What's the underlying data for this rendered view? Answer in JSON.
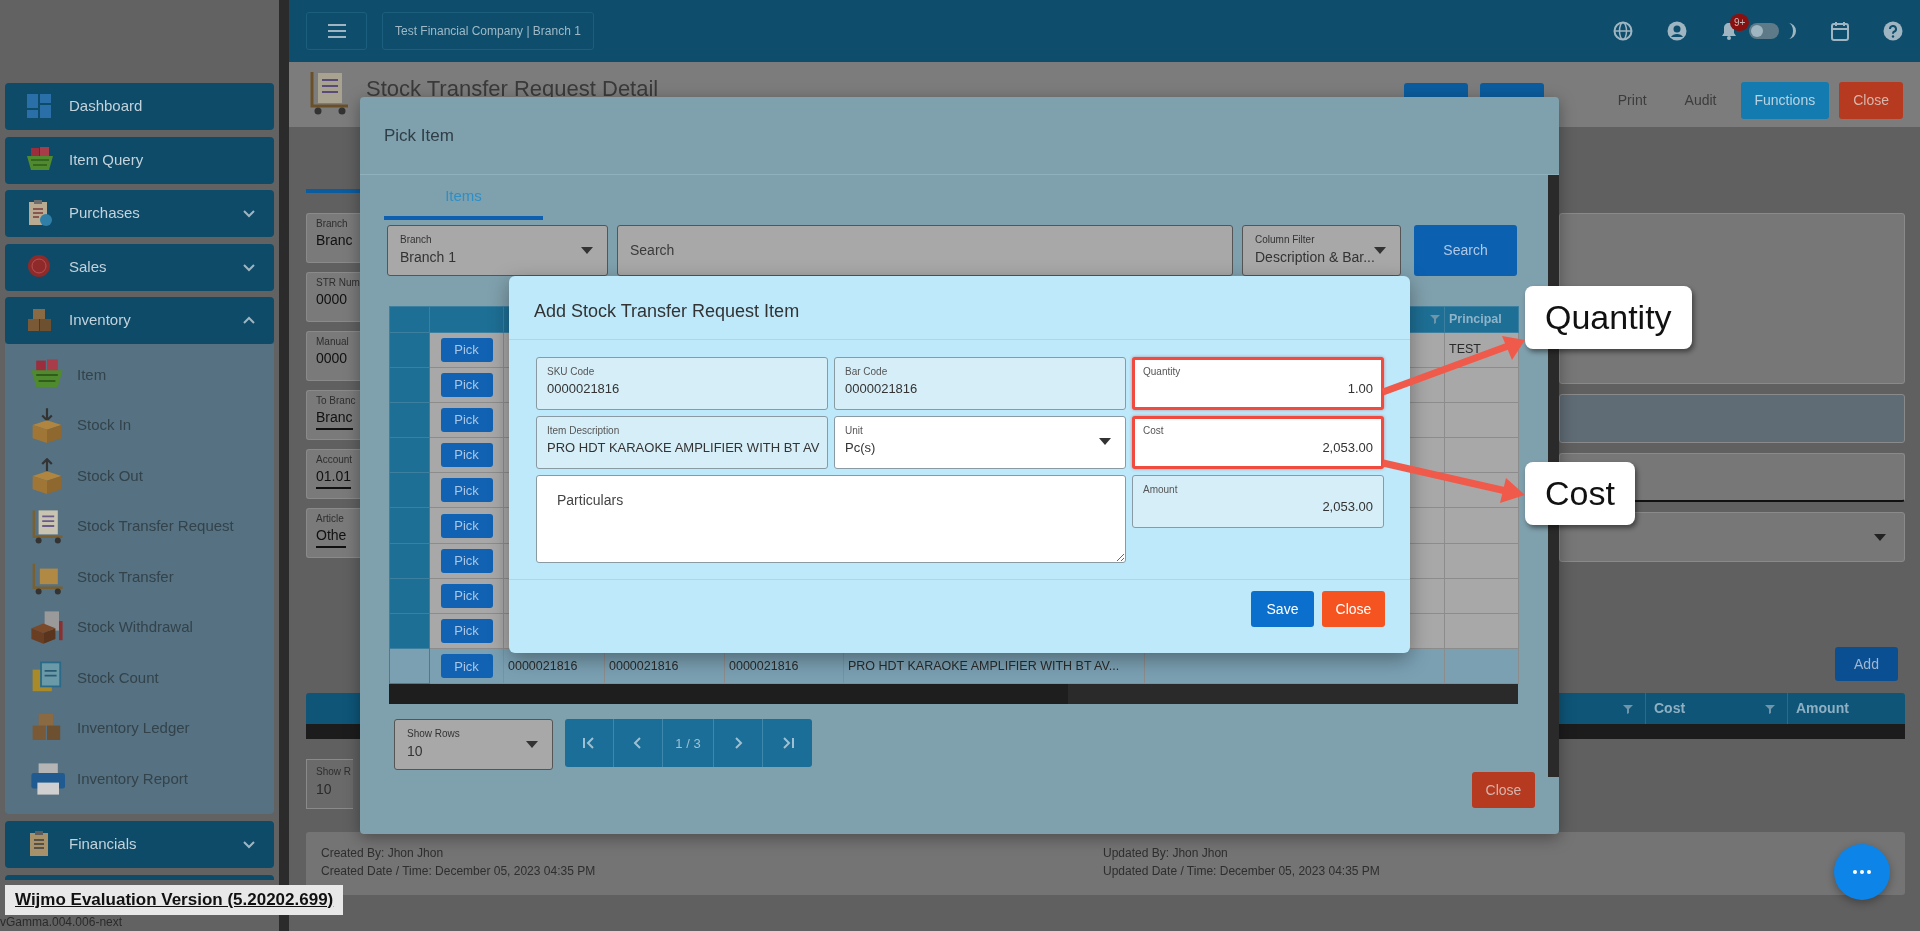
{
  "top_bar": {
    "company": "Test Financial Company | Branch 1",
    "notification_badge": "9+",
    "dark_mode": false
  },
  "sidebar": {
    "items": [
      {
        "label": "Dashboard",
        "kind": "link"
      },
      {
        "label": "Item Query",
        "kind": "link"
      },
      {
        "label": "Purchases",
        "kind": "group",
        "expanded": false
      },
      {
        "label": "Sales",
        "kind": "group",
        "expanded": false
      },
      {
        "label": "Inventory",
        "kind": "group",
        "expanded": true,
        "children": [
          {
            "label": "Item"
          },
          {
            "label": "Stock In"
          },
          {
            "label": "Stock Out"
          },
          {
            "label": "Stock Transfer Request"
          },
          {
            "label": "Stock Transfer"
          },
          {
            "label": "Stock Withdrawal"
          },
          {
            "label": "Stock Count"
          },
          {
            "label": "Inventory Ledger"
          },
          {
            "label": "Inventory Report"
          }
        ]
      },
      {
        "label": "Financials",
        "kind": "group",
        "expanded": false
      }
    ]
  },
  "page": {
    "title": "Stock Transfer Request Detail",
    "toolbar": [
      {
        "label": "Print",
        "kind": "text"
      },
      {
        "label": "Audit",
        "kind": "text"
      },
      {
        "label": "Functions",
        "kind": "primary"
      },
      {
        "label": "Close",
        "kind": "danger"
      }
    ],
    "form_fields": [
      {
        "label": "Branch",
        "value": "Branc",
        "underlined": false
      },
      {
        "label": "STR Num",
        "value": "0000",
        "underlined": false
      },
      {
        "label": "Manual",
        "value": "0000",
        "underlined": false
      },
      {
        "label": "To Branc",
        "value": "Branc",
        "underlined": true
      },
      {
        "label": "Account",
        "value": "01.01",
        "underlined": true
      },
      {
        "label": "Article",
        "value": "Othe",
        "underlined": true
      }
    ],
    "add_button": "Add",
    "details_table": {
      "columns": [
        "Cost",
        "Amount"
      ]
    },
    "show_rows": {
      "label": "Show R",
      "value": "10"
    },
    "footer": {
      "created_by": "Created By: Jhon Jhon",
      "created_date": "Created Date / Time: December 05, 2023 04:35 PM",
      "updated_by": "Updated By: Jhon Jhon",
      "updated_date": "Updated Date / Time: December 05, 2023 04:35 PM"
    }
  },
  "pick_item_modal": {
    "title": "Pick Item",
    "tabs": [
      {
        "label": "Items",
        "selected": true
      }
    ],
    "branch": {
      "label": "Branch",
      "value": "Branch 1"
    },
    "search": {
      "placeholder": "Search"
    },
    "column_filter": {
      "label": "Column Filter",
      "value": "Description & Bar..."
    },
    "search_button": "Search",
    "grid": {
      "columns": [
        "Principal"
      ],
      "rows": [
        {
          "action": "Pick",
          "selected": false,
          "principal": "TEST"
        },
        {
          "action": "Pick",
          "selected": false
        },
        {
          "action": "Pick",
          "selected": false
        },
        {
          "action": "Pick",
          "selected": false
        },
        {
          "action": "Pick",
          "selected": false
        },
        {
          "action": "Pick",
          "selected": false
        },
        {
          "action": "Pick",
          "selected": false
        },
        {
          "action": "Pick",
          "selected": false
        },
        {
          "action": "Pick",
          "selected": false
        },
        {
          "action": "Pick",
          "selected": true,
          "cells": [
            "0000021816",
            "0000021816",
            "0000021816",
            "PRO HDT KARAOKE AMPLIFIER WITH BT AV..."
          ]
        }
      ]
    },
    "show_rows": {
      "label": "Show Rows",
      "value": "10"
    },
    "page": "1 / 3",
    "close_button": "Close"
  },
  "add_item_modal": {
    "title": "Add Stock Transfer Request Item",
    "fields": [
      {
        "label": "SKU Code",
        "value": "0000021816",
        "kind": "readonly",
        "highlighted": false
      },
      {
        "label": "Bar Code",
        "value": "0000021816",
        "kind": "readonly",
        "highlighted": false
      },
      {
        "label": "Quantity",
        "value": "1.00",
        "kind": "number",
        "highlighted": true
      },
      {
        "label": "Item Description",
        "value": "PRO HDT KARAOKE AMPLIFIER WITH BT AV",
        "kind": "readonly",
        "highlighted": false
      },
      {
        "label": "Unit",
        "value": "Pc(s)",
        "kind": "select",
        "highlighted": false
      },
      {
        "label": "Cost",
        "value": "2,053.00",
        "kind": "number",
        "highlighted": true
      },
      {
        "placeholder": "Particulars",
        "kind": "textarea",
        "highlighted": false
      },
      {
        "label": "Amount",
        "value": "2,053.00",
        "kind": "readonly_number",
        "highlighted": false
      }
    ],
    "buttons": [
      {
        "label": "Save",
        "kind": "primary"
      },
      {
        "label": "Close",
        "kind": "danger"
      }
    ]
  },
  "callouts": [
    {
      "label": "Quantity"
    },
    {
      "label": "Cost"
    }
  ],
  "evaluation_banner": "Wijmo Evaluation Version (5.20202.699)",
  "version": "vGamma.004.006-next"
}
